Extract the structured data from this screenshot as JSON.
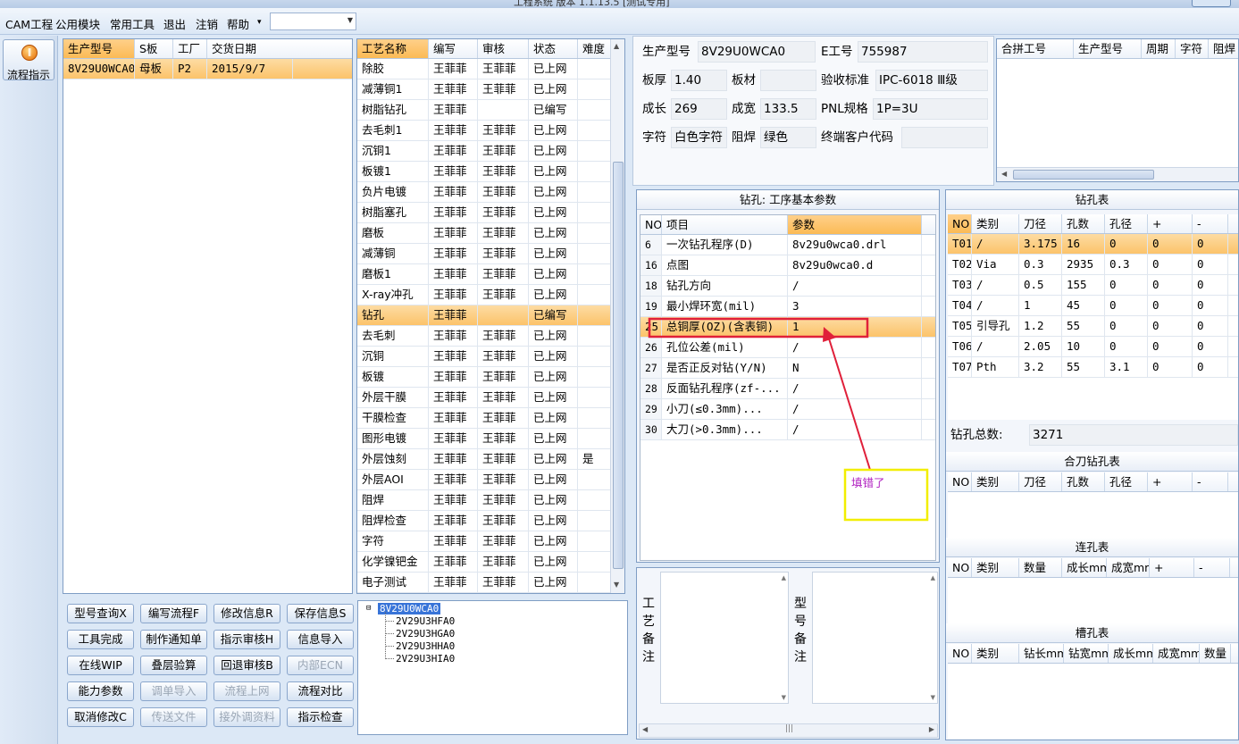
{
  "window": {
    "title": "工程系统  版本 1.1.13.5  [测试专用]"
  },
  "menu": {
    "items": [
      "CAM工程",
      "公用模块",
      "常用工具",
      "退出",
      "注销",
      "帮助"
    ],
    "dropdown_arrow": "▾",
    "combo_value": ""
  },
  "sidebar": {
    "flow_button": "流程指示",
    "icon": "pause-circle-icon"
  },
  "orders": {
    "headers": [
      "生产型号",
      "S板",
      "工厂",
      "交货日期"
    ],
    "rows": [
      [
        "8V29U0WCA0",
        "母板",
        "P2",
        "2015/9/7"
      ]
    ]
  },
  "process": {
    "headers": [
      "工艺名称",
      "编写",
      "审核",
      "状态",
      "难度"
    ],
    "rows": [
      [
        "除胶",
        "王菲菲",
        "王菲菲",
        "已上网",
        ""
      ],
      [
        "减薄铜1",
        "王菲菲",
        "王菲菲",
        "已上网",
        ""
      ],
      [
        "树脂钻孔",
        "王菲菲",
        "",
        "已编写",
        ""
      ],
      [
        "去毛刺1",
        "王菲菲",
        "王菲菲",
        "已上网",
        ""
      ],
      [
        "沉铜1",
        "王菲菲",
        "王菲菲",
        "已上网",
        ""
      ],
      [
        "板镀1",
        "王菲菲",
        "王菲菲",
        "已上网",
        ""
      ],
      [
        "负片电镀",
        "王菲菲",
        "王菲菲",
        "已上网",
        ""
      ],
      [
        "树脂塞孔",
        "王菲菲",
        "王菲菲",
        "已上网",
        ""
      ],
      [
        "磨板",
        "王菲菲",
        "王菲菲",
        "已上网",
        ""
      ],
      [
        "减薄铜",
        "王菲菲",
        "王菲菲",
        "已上网",
        ""
      ],
      [
        "磨板1",
        "王菲菲",
        "王菲菲",
        "已上网",
        ""
      ],
      [
        "X-ray冲孔",
        "王菲菲",
        "王菲菲",
        "已上网",
        ""
      ],
      [
        "钻孔",
        "王菲菲",
        "",
        "已编写",
        ""
      ],
      [
        "去毛刺",
        "王菲菲",
        "王菲菲",
        "已上网",
        ""
      ],
      [
        "沉铜",
        "王菲菲",
        "王菲菲",
        "已上网",
        ""
      ],
      [
        "板镀",
        "王菲菲",
        "王菲菲",
        "已上网",
        ""
      ],
      [
        "外层干膜",
        "王菲菲",
        "王菲菲",
        "已上网",
        ""
      ],
      [
        "干膜检查",
        "王菲菲",
        "王菲菲",
        "已上网",
        ""
      ],
      [
        "图形电镀",
        "王菲菲",
        "王菲菲",
        "已上网",
        ""
      ],
      [
        "外层蚀刻",
        "王菲菲",
        "王菲菲",
        "已上网",
        "是"
      ],
      [
        "外层AOI",
        "王菲菲",
        "王菲菲",
        "已上网",
        ""
      ],
      [
        "阻焊",
        "王菲菲",
        "王菲菲",
        "已上网",
        ""
      ],
      [
        "阻焊检查",
        "王菲菲",
        "王菲菲",
        "已上网",
        ""
      ],
      [
        "字符",
        "王菲菲",
        "王菲菲",
        "已上网",
        ""
      ],
      [
        "化学镍钯金",
        "王菲菲",
        "王菲菲",
        "已上网",
        ""
      ],
      [
        "电子测试",
        "王菲菲",
        "王菲菲",
        "已上网",
        ""
      ]
    ]
  },
  "buttons": [
    [
      "型号查询X",
      "编写流程F",
      "修改信息R",
      "保存信息S"
    ],
    [
      "工具完成",
      "制作通知单",
      "指示审核H",
      "信息导入"
    ],
    [
      "在线WIP",
      "叠层验算",
      "回退审核B",
      "内部ECN"
    ],
    [
      "能力参数",
      "调单导入",
      "流程上网",
      "流程对比"
    ],
    [
      "取消修改C",
      "传送文件",
      "接外调资料",
      "指示检查"
    ]
  ],
  "tree": {
    "root": "8V29U0WCA0",
    "children": [
      "2V29U3HFA0",
      "2V29U3HGA0",
      "2V29U3HHA0",
      "2V29U3HIA0"
    ]
  },
  "info": {
    "model_label": "生产型号",
    "model": "8V29U0WCA0",
    "e_label": "E工号",
    "e": "755987",
    "thick_label": "板厚",
    "thick": "1.40",
    "material_label": "板材",
    "material": "",
    "std_label": "验收标准",
    "std": "IPC-6018 Ⅲ级",
    "len_label": "成长",
    "len": "269",
    "wid_label": "成宽",
    "wid": "133.5",
    "pnl_label": "PNL规格",
    "pnl": "1P=3U",
    "char_label": "字符",
    "char": "白色字符",
    "mask_label": "阻焊",
    "mask": "绿色",
    "cust_label": "终端客户代码",
    "cust": ""
  },
  "combined": {
    "headers": [
      "合拼工号",
      "生产型号",
      "周期",
      "字符",
      "阻焊"
    ]
  },
  "drill_params": {
    "title": "钻孔: 工序基本参数",
    "headers": [
      "NO",
      "项目",
      "参数"
    ],
    "rows": [
      [
        "6",
        "一次钻孔程序(D)",
        "8v29u0wca0.drl"
      ],
      [
        "16",
        "点图",
        "8v29u0wca0.d"
      ],
      [
        "18",
        "钻孔方向",
        "/"
      ],
      [
        "19",
        "最小焊环宽(mil)",
        "3"
      ],
      [
        "25",
        "总铜厚(OZ)(含表铜)",
        "1"
      ],
      [
        "26",
        "孔位公差(mil)",
        "/"
      ],
      [
        "27",
        "是否正反对钻(Y/N)",
        "N"
      ],
      [
        "28",
        "反面钻孔程序(zf-...",
        "/"
      ],
      [
        "29",
        "小刀(≤0.3mm)...",
        "/"
      ],
      [
        "30",
        "大刀(>0.3mm)...",
        "/"
      ]
    ],
    "annotation": "填错了",
    "highlight_color": "#e0203a",
    "note_color": "#f2ee00"
  },
  "remarks": {
    "process_label": "工艺备注",
    "model_label": "型号备注"
  },
  "drill_table": {
    "title": "钻孔表",
    "headers": [
      "NO",
      "类别",
      "刀径",
      "孔数",
      "孔径",
      "+",
      "-"
    ],
    "rows": [
      [
        "T01",
        "/",
        "3.175",
        "16",
        "0",
        "0",
        "0"
      ],
      [
        "T02",
        "Via",
        "0.3",
        "2935",
        "0.3",
        "0",
        "0"
      ],
      [
        "T03",
        "/",
        "0.5",
        "155",
        "0",
        "0",
        "0"
      ],
      [
        "T04",
        "/",
        "1",
        "45",
        "0",
        "0",
        "0"
      ],
      [
        "T05",
        "引导孔",
        "1.2",
        "55",
        "0",
        "0",
        "0"
      ],
      [
        "T06",
        "/",
        "2.05",
        "10",
        "0",
        "0",
        "0"
      ],
      [
        "T07",
        "Pth",
        "3.2",
        "55",
        "3.1",
        "0",
        "0"
      ]
    ],
    "total_label": "钻孔总数:",
    "total": "3271"
  },
  "combined_drill": {
    "title": "合刀钻孔表",
    "headers": [
      "NO",
      "类别",
      "刀径",
      "孔数",
      "孔径",
      "+",
      "-"
    ]
  },
  "link_holes": {
    "title": "连孔表",
    "headers": [
      "NO",
      "类别",
      "数量",
      "成长mm",
      "成宽mm",
      "+",
      "-"
    ]
  },
  "slot_holes": {
    "title": "槽孔表",
    "headers": [
      "NO",
      "类别",
      "钻长mm",
      "钻宽mm",
      "成长mm",
      "成宽mm",
      "数量"
    ]
  }
}
